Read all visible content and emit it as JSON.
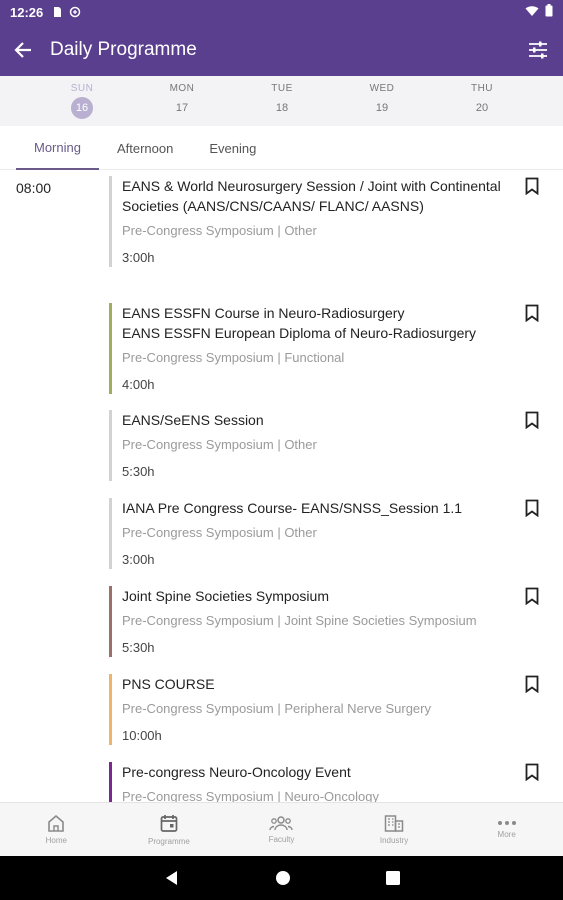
{
  "status": {
    "time": "12:26"
  },
  "appbar": {
    "title": "Daily Programme"
  },
  "days": [
    {
      "name": "SUN",
      "num": "16",
      "active": true
    },
    {
      "name": "MON",
      "num": "17",
      "active": false
    },
    {
      "name": "TUE",
      "num": "18",
      "active": false
    },
    {
      "name": "WED",
      "num": "19",
      "active": false
    },
    {
      "name": "THU",
      "num": "20",
      "active": false
    }
  ],
  "tabs": [
    {
      "label": "Morning",
      "active": true
    },
    {
      "label": "Afternoon",
      "active": false
    },
    {
      "label": "Evening",
      "active": false
    }
  ],
  "time_slot": "08:00",
  "sessions": [
    {
      "title": "EANS & World Neurosurgery Session / Joint with Continental Societies (AANS/CNS/CAANS/ FLANC/ AASNS)",
      "category": "Pre-Congress Symposium | Other",
      "duration": "3:00h",
      "color": "#d2d2d2"
    },
    {
      "title": "EANS ESSFN Course in Neuro-Radiosurgery\nEANS ESSFN European Diploma of Neuro-Radiosurgery",
      "category": "Pre-Congress Symposium | Functional",
      "duration": "4:00h",
      "color": "#9fae5b"
    },
    {
      "title": "EANS/SeENS Session",
      "category": "Pre-Congress Symposium | Other",
      "duration": "5:30h",
      "color": "#d2d2d2"
    },
    {
      "title": "IANA Pre Congress Course- EANS/SNSS_Session 1.1",
      "category": "Pre-Congress Symposium | Other",
      "duration": "3:00h",
      "color": "#d2d2d2"
    },
    {
      "title": "Joint Spine Societies Symposium",
      "category": "Pre-Congress Symposium | Joint Spine Societies Symposium",
      "duration": "5:30h",
      "color": "#9b6f6a"
    },
    {
      "title": "PNS COURSE",
      "category": "Pre-Congress Symposium | Peripheral Nerve Surgery",
      "duration": "10:00h",
      "color": "#f0b36a"
    },
    {
      "title": "Pre-congress Neuro-Oncology Event",
      "category": "Pre-Congress Symposium | Neuro-Oncology",
      "duration": "",
      "color": "#7a2a8f"
    }
  ],
  "bottomnav": [
    {
      "label": "Home",
      "icon": "home-icon"
    },
    {
      "label": "Programme",
      "icon": "calendar-icon"
    },
    {
      "label": "Faculty",
      "icon": "people-icon"
    },
    {
      "label": "Industry",
      "icon": "building-icon"
    },
    {
      "label": "More",
      "icon": "more-icon"
    }
  ]
}
